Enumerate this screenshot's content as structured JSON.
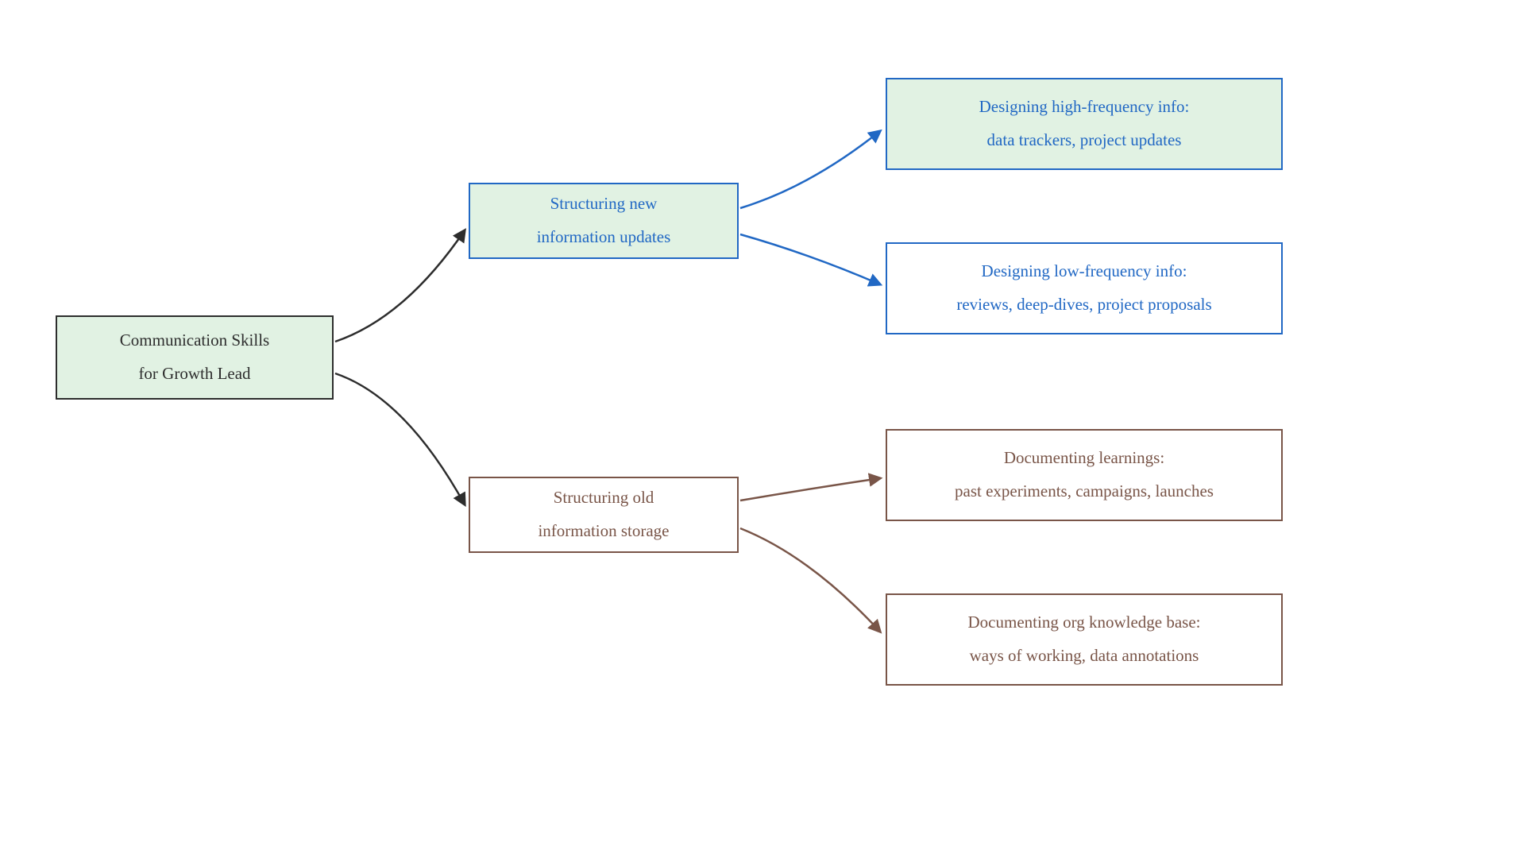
{
  "root": {
    "line1": "Communication Skills",
    "line2": "for Growth Lead"
  },
  "branch1": {
    "line1": "Structuring new",
    "line2": "information updates"
  },
  "branch2": {
    "line1": "Structuring old",
    "line2": "information storage"
  },
  "leaf1": {
    "line1": "Designing high-frequency info:",
    "line2": "data trackers, project updates"
  },
  "leaf2": {
    "line1": "Designing low-frequency info:",
    "line2": "reviews, deep-dives, project proposals"
  },
  "leaf3": {
    "line1": "Documenting learnings:",
    "line2": "past experiments, campaigns, launches"
  },
  "leaf4": {
    "line1": "Documenting org knowledge base:",
    "line2": "ways of working, data annotations"
  },
  "colors": {
    "black": "#2d2d2d",
    "blue": "#2168c4",
    "brown": "#795548",
    "greenFill": "#e1f2e3"
  }
}
